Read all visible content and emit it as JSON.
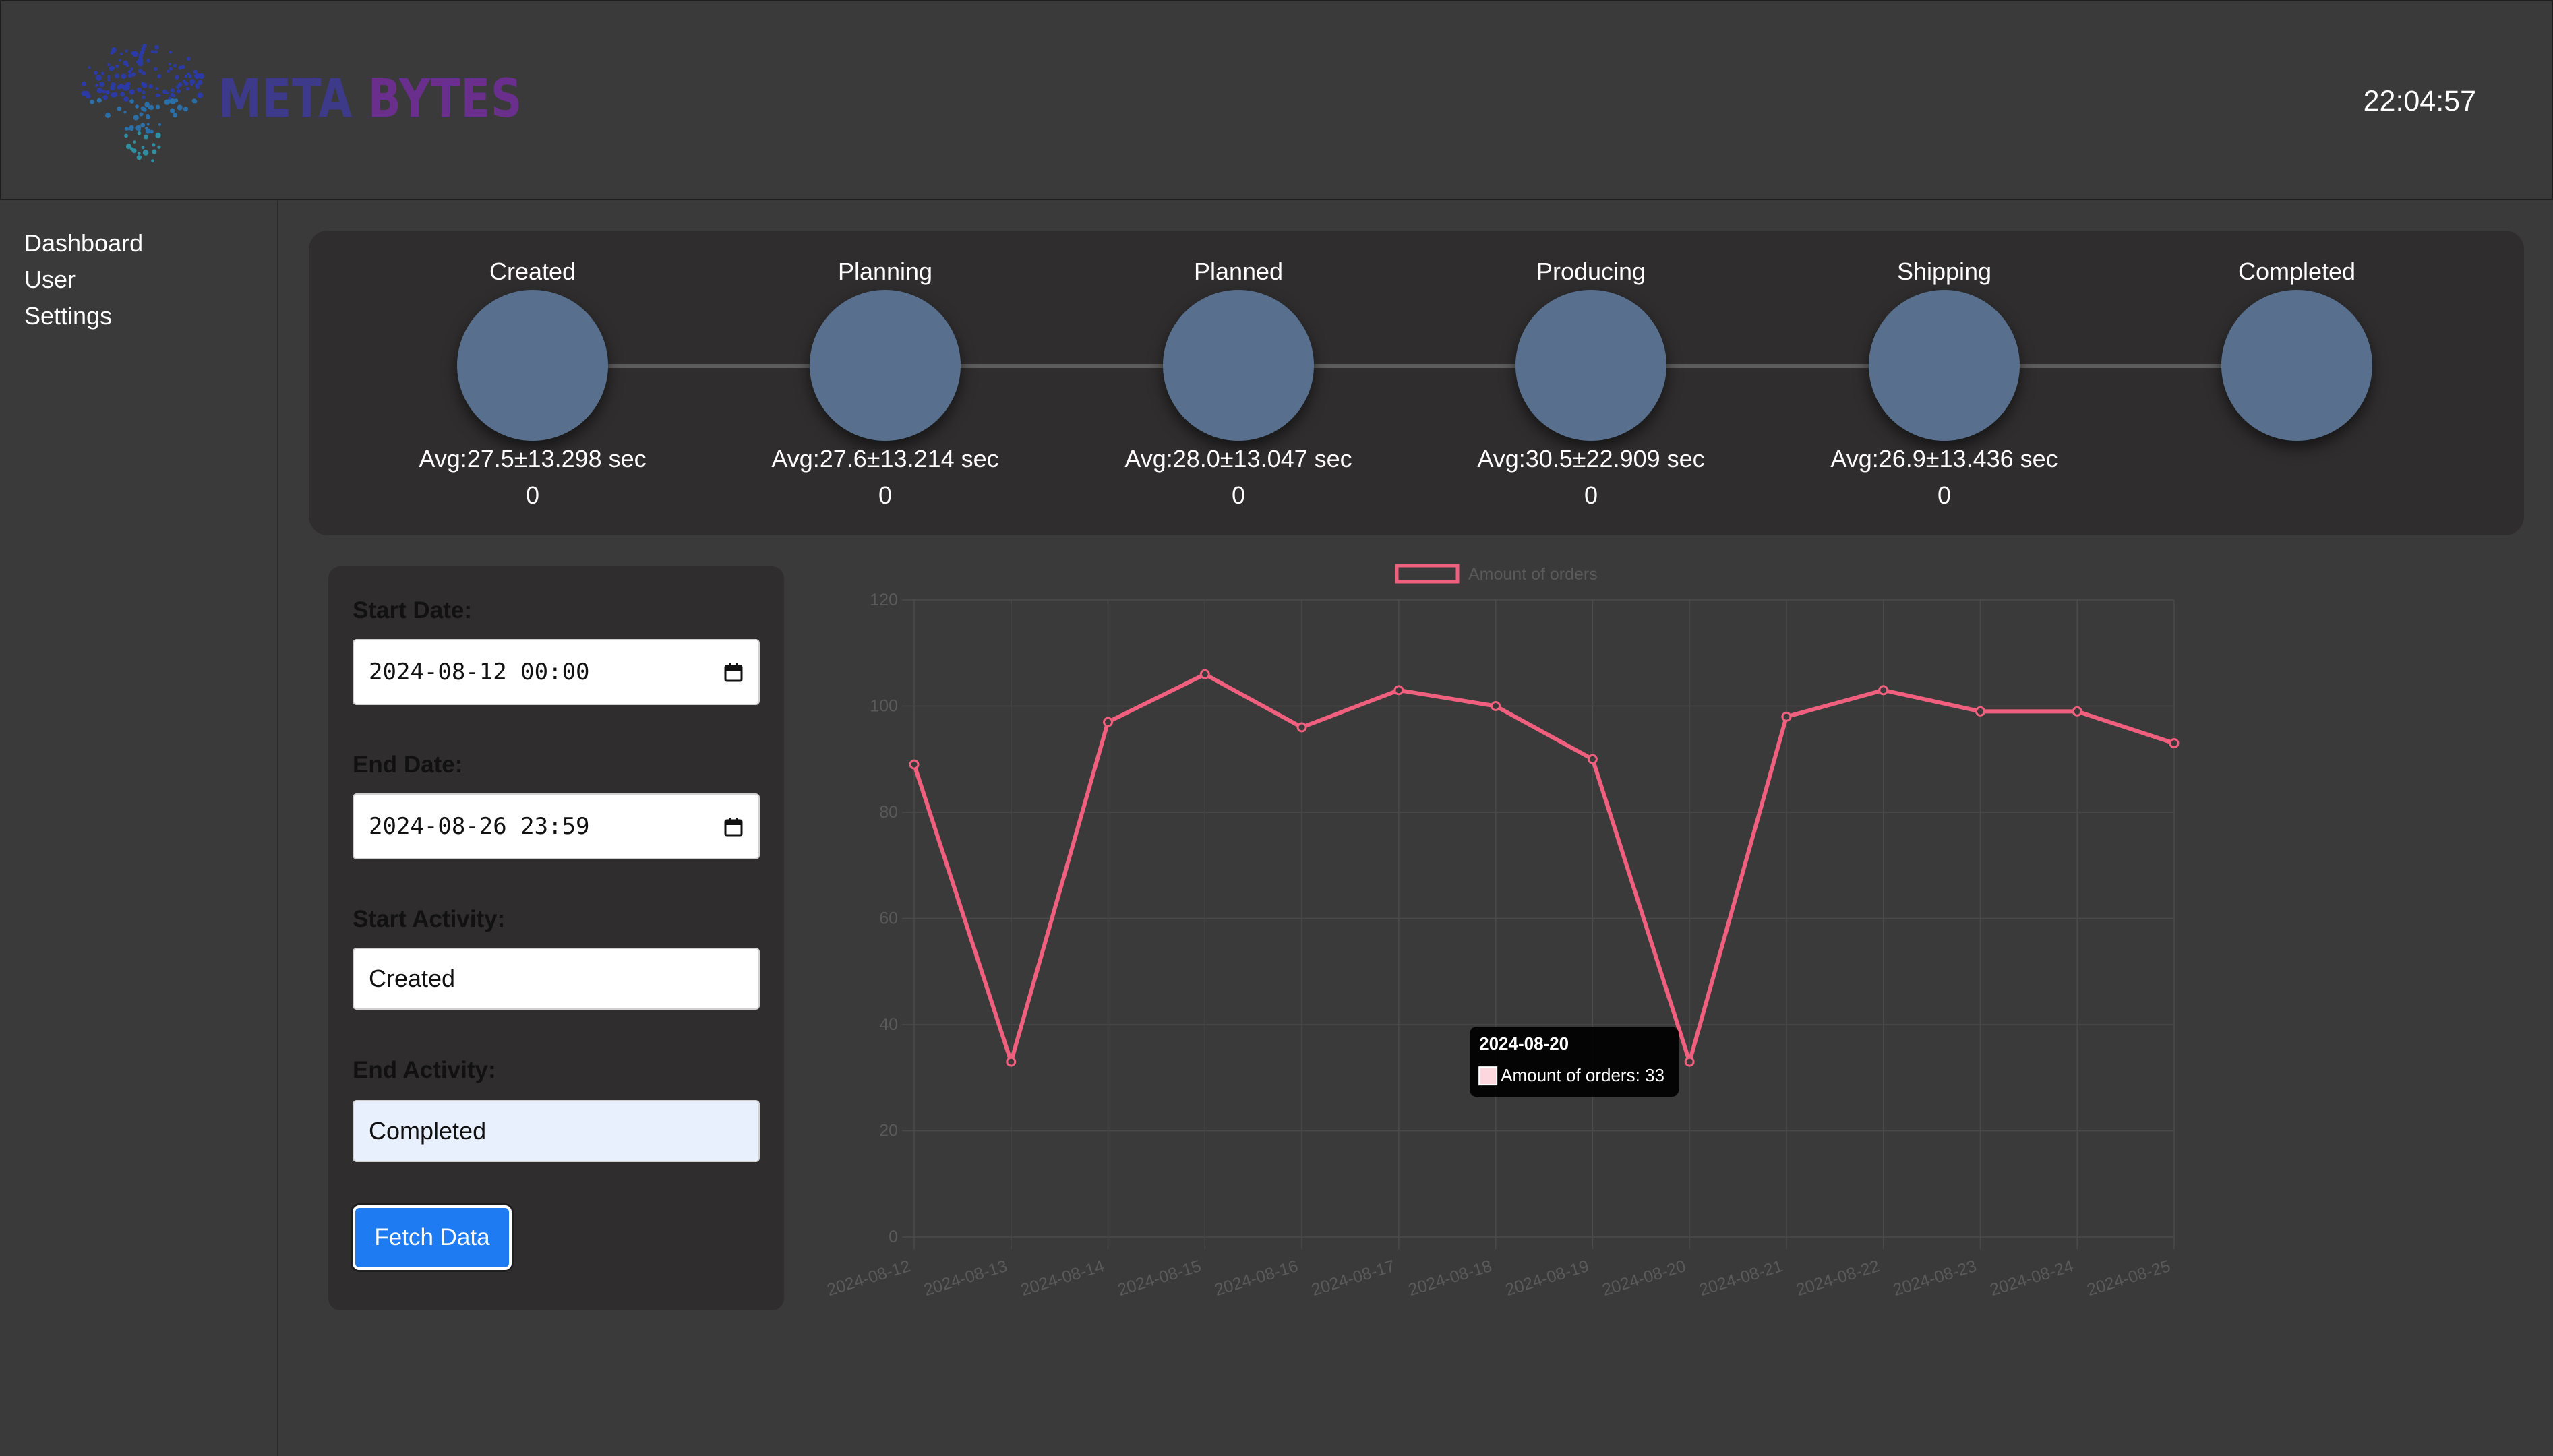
{
  "header": {
    "logo_text_a": "META",
    "logo_text_b": "BYTES",
    "clock": "22:04:57"
  },
  "sidebar": {
    "items": [
      {
        "label": "Dashboard"
      },
      {
        "label": "User"
      },
      {
        "label": "Settings"
      }
    ]
  },
  "tracker": {
    "stages": [
      {
        "label": "Created",
        "avg": "Avg:27.5±13.298 sec",
        "count": "0"
      },
      {
        "label": "Planning",
        "avg": "Avg:27.6±13.214 sec",
        "count": "0"
      },
      {
        "label": "Planned",
        "avg": "Avg:28.0±13.047 sec",
        "count": "0"
      },
      {
        "label": "Producing",
        "avg": "Avg:30.5±22.909 sec",
        "count": "0"
      },
      {
        "label": "Shipping",
        "avg": "Avg:26.9±13.436 sec",
        "count": "0"
      },
      {
        "label": "Completed",
        "avg": "",
        "count": ""
      }
    ]
  },
  "form": {
    "start_date_label": "Start Date:",
    "start_date_value": "2024-08-12 00:00",
    "end_date_label": "End Date:",
    "end_date_value": "2024-08-26 23:59",
    "start_activity_label": "Start Activity:",
    "start_activity_value": "Created",
    "end_activity_label": "End Activity:",
    "end_activity_value": "Completed",
    "fetch_label": "Fetch Data"
  },
  "colors": {
    "line": "#f0607e",
    "circle": "#58708e",
    "button": "#1f7bf2",
    "panel": "#2f2d2e",
    "background": "#3a3a3a"
  },
  "chart_data": {
    "type": "line",
    "categories": [
      "2024-08-12",
      "2024-08-13",
      "2024-08-14",
      "2024-08-15",
      "2024-08-16",
      "2024-08-17",
      "2024-08-18",
      "2024-08-19",
      "2024-08-20",
      "2024-08-21",
      "2024-08-22",
      "2024-08-23",
      "2024-08-24",
      "2024-08-25"
    ],
    "series": [
      {
        "name": "Amount of orders",
        "values": [
          89,
          33,
          97,
          106,
          96,
          103,
          100,
          90,
          33,
          98,
          103,
          99,
          99,
          93
        ]
      }
    ],
    "ylim": [
      0,
      120
    ],
    "yticks": [
      0,
      20,
      40,
      60,
      80,
      100,
      120
    ],
    "grid": true,
    "legend": "top",
    "tooltip": {
      "title": "2024-08-20",
      "body": "Amount of orders: 33"
    }
  }
}
